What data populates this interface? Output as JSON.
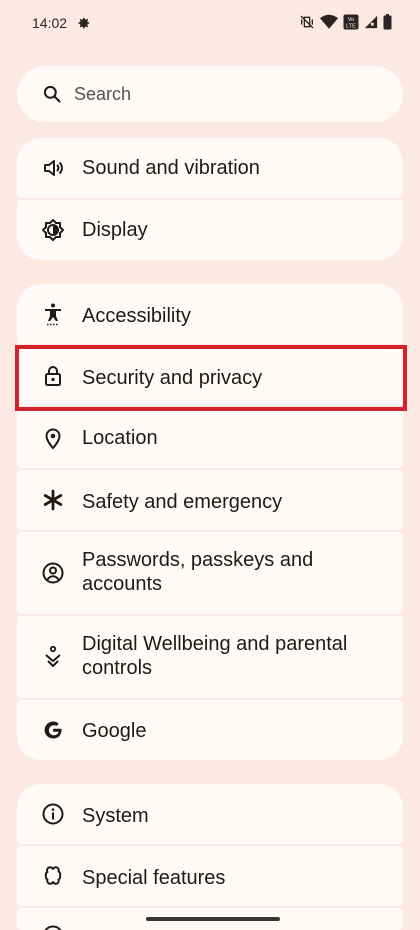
{
  "status_bar": {
    "time": "14:02",
    "icons": [
      "settings-gear-icon",
      "vibrate-off-icon",
      "wifi-icon",
      "volte-icon",
      "signal-icon",
      "battery-icon"
    ],
    "volte_text": "Vo LTE"
  },
  "search": {
    "label": "Search",
    "icon": "search-icon"
  },
  "groups": [
    {
      "items": [
        {
          "label": "Sound and vibration",
          "icon": "speaker-icon"
        },
        {
          "label": "Display",
          "icon": "brightness-icon"
        }
      ]
    },
    {
      "items": [
        {
          "label": "Accessibility",
          "icon": "accessibility-icon"
        },
        {
          "label": "Security and privacy",
          "icon": "lock-icon",
          "highlighted": true
        },
        {
          "label": "Location",
          "icon": "location-pin-icon"
        },
        {
          "label": "Safety and emergency",
          "icon": "asterisk-icon"
        },
        {
          "label": "Passwords, passkeys and\naccounts",
          "icon": "account-circle-icon"
        },
        {
          "label": "Digital Wellbeing and parental\ncontrols",
          "icon": "wellbeing-icon"
        },
        {
          "label": "Google",
          "icon": "google-g-icon"
        }
      ]
    },
    {
      "items": [
        {
          "label": "System",
          "icon": "info-icon"
        },
        {
          "label": "Special features",
          "icon": "special-features-icon"
        }
      ]
    }
  ],
  "colors": {
    "background": "#fce9e3",
    "card": "#fffaf8",
    "highlight": "#d4222b"
  }
}
